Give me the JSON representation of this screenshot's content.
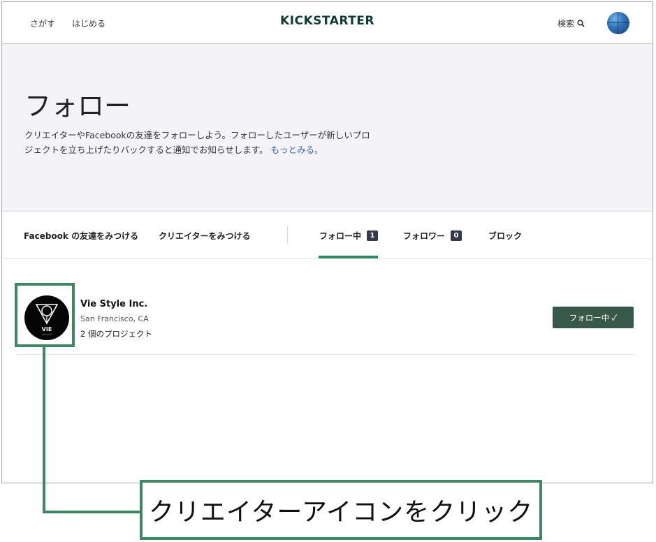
{
  "header": {
    "nav_search": "さがす",
    "nav_start": "はじめる",
    "logo": "KICKSTARTER",
    "search_label": "検索"
  },
  "hero": {
    "title": "フォロー",
    "description": "クリエイターやFacebookの友達をフォローしよう。フォローしたユーザーが新しいプロジェクトを立ち上げたりバックすると通知でお知らせします。",
    "more_link": "もっとみる。"
  },
  "tabs": {
    "find_facebook": "Facebook の友達をみつける",
    "find_creators": "クリエイターをみつける",
    "following": "フォロー中",
    "following_count": "1",
    "followers": "フォロワー",
    "followers_count": "0",
    "blocked": "ブロック"
  },
  "creator": {
    "name": "Vie Style Inc.",
    "location": "San Francisco, CA",
    "projects": "2 個のプロジェクト",
    "avatar_text": "VIE",
    "follow_button": "フォロー中 ✓"
  },
  "annotation": {
    "callout": "クリエイターアイコンをクリック",
    "color": "#3d8764"
  },
  "colors": {
    "logo": "#0f3b32",
    "accent": "#2f8a63",
    "button": "#37584a",
    "link": "#3b5fa8"
  }
}
